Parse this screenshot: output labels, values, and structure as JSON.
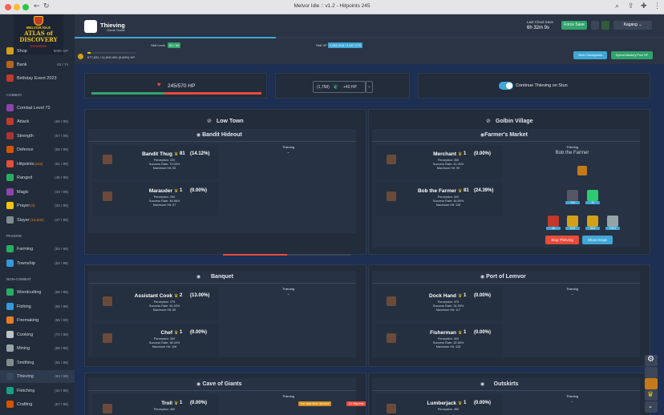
{
  "window": {
    "title": "Melvor Idle :: v1.2 - Hitpoints 245"
  },
  "logo": {
    "top": "MELVOR IDLE",
    "main": "ATLAS of DISCOVERY",
    "sub": "EXPANSION"
  },
  "sidebar": {
    "shop": {
      "label": "Shop",
      "badge": "500K GP"
    },
    "bank": {
      "label": "Bank",
      "count": "63 / 74"
    },
    "event": {
      "label": "Birthday Event 2023"
    },
    "combat_header": "COMBAT",
    "combat_level": "Combat Level 72",
    "combat": [
      {
        "label": "Attack",
        "count": "(65 / 99)",
        "sub": ""
      },
      {
        "label": "Strength",
        "count": "(57 / 99)",
        "sub": ""
      },
      {
        "label": "Defence",
        "count": "(55 / 99)",
        "sub": ""
      },
      {
        "label": "Hitpoints",
        "count": "(61 / 99)",
        "sub": "(245)"
      },
      {
        "label": "Ranged",
        "count": "(45 / 99)",
        "sub": ""
      },
      {
        "label": "Magic",
        "count": "(10 / 99)",
        "sub": ""
      },
      {
        "label": "Prayer",
        "count": "(20 / 99)",
        "sub": "(0)"
      },
      {
        "label": "Slayer",
        "count": "(47 / 99)",
        "sub": "(15,530)"
      }
    ],
    "passive_header": "PASSIVE",
    "passive": [
      {
        "label": "Farming",
        "count": "(62 / 99)"
      },
      {
        "label": "Township",
        "count": "(52 / 99)"
      }
    ],
    "noncombat_header": "NON-COMBAT",
    "noncombat": [
      {
        "label": "Woodcutting",
        "count": "(56 / 99)"
      },
      {
        "label": "Fishing",
        "count": "(68 / 99)"
      },
      {
        "label": "Firemaking",
        "count": "(56 / 99)"
      },
      {
        "label": "Cooking",
        "count": "(70 / 99)"
      },
      {
        "label": "Mining",
        "count": "(58 / 99)"
      },
      {
        "label": "Smithing",
        "count": "(56 / 99)"
      },
      {
        "label": "Thieving",
        "count": "(83 / 99)"
      },
      {
        "label": "Fletching",
        "count": "(34 / 99)"
      },
      {
        "label": "Crafting",
        "count": "(57 / 99)"
      }
    ]
  },
  "header": {
    "title": "Thieving",
    "subtitle": "Game Guide",
    "last_save_label": "Last Cloud Save",
    "last_save": "6h 32m 9s",
    "force_save": "Force Save",
    "user": "Kagang",
    "skill_level_label": "Skill Level",
    "skill_level": "83 / 99",
    "skill_xp_label": "Skill XP",
    "skill_xp": "2,651,918 / 2,827,075",
    "mastery_xp": "677,831 / 11,500,000 (5.89%) XP",
    "skill_progress": 0.9,
    "mastery_progress": 0.06,
    "view_checkpoints": "View Checkpoints",
    "spend_mastery": "Spend Mastery Pool XP"
  },
  "status": {
    "hp": "245/570 HP",
    "hp_fraction": 0.43,
    "food_qty": "(1,758)",
    "food_heal": "+40 HP",
    "toggle_label": "Continue Thieving on Stun"
  },
  "areas": [
    {
      "name": "Low Town",
      "cards": [
        {
          "title": "Bandit Hideout",
          "npcs": [
            {
              "name": "Bandit Thug",
              "mastery": "81",
              "pct": "(14.12%)",
              "stats": [
                "Perception: 220",
                "Success Rate: 70.00%",
                "Maximum Hit: 53"
              ]
            },
            {
              "name": "Marauder",
              "mastery": "1",
              "pct": "(0.00%)",
              "stats": [
                "Perception: 250",
                "Success Rate: 48.86%",
                "Maximum Hit: 67"
              ]
            }
          ],
          "thieving_label": "Thieving",
          "thieving_value": "-"
        }
      ]
    },
    {
      "name": "Golbin Village",
      "cards": [
        {
          "title": "Farmer's Market",
          "npcs": [
            {
              "name": "Merchant",
              "mastery": "1",
              "pct": "(0.00%)",
              "stats": [
                "Perception: 350",
                "Success Rate: 41.00%",
                "Maximum Hit: 99"
              ]
            },
            {
              "name": "Bob the Farmer",
              "mastery": "81",
              "pct": "(24.39%)",
              "stats": [
                "Perception: 420",
                "Success Rate: 46.80%",
                "Maximum Hit: 135"
              ]
            }
          ],
          "thieving_label": "Thieving",
          "thieving_value": "Bob the Farmer",
          "drops": [
            "144",
            "48",
            "38",
            "26.8",
            "26.8",
            "2,824"
          ],
          "stop": "Stop Thieving",
          "show_drops": "Show Drops"
        }
      ]
    }
  ],
  "cards2": [
    {
      "title": "Banquet",
      "npcs": [
        {
          "name": "Assistant Cook",
          "mastery": "2",
          "pct": "(13.00%)",
          "stats": [
            "Perception: 275",
            "Success Rate: 64.00%",
            "Maximum Hit: 85"
          ]
        },
        {
          "name": "Chef",
          "mastery": "1",
          "pct": "(0.00%)",
          "stats": [
            "Perception: 350",
            "Success Rate: 38.44%",
            "Maximum Hit: 106"
          ]
        }
      ],
      "thieving_label": "Thieving",
      "thieving_value": "-"
    },
    {
      "title": "Port of Lemvor",
      "npcs": [
        {
          "name": "Dock Hand",
          "mastery": "1",
          "pct": "(0.00%)",
          "stats": [
            "Perception: 375",
            "Success Rate: 34.53%",
            "Maximum Hit: 117"
          ]
        },
        {
          "name": "Fisherman",
          "mastery": "1",
          "pct": "(0.00%)",
          "stats": [
            "Perception: 400",
            "Success Rate: 32.80%",
            "Maximum Hit: 128"
          ]
        }
      ],
      "thieving_label": "Thieving",
      "thieving_value": "-"
    },
    {
      "title": "Cave of Giants",
      "npcs": [
        {
          "name": "Troll",
          "mastery": "1",
          "pct": "(0.00%)",
          "stats": [
            "Perception: 450"
          ]
        }
      ],
      "thieving_label": "Thieving",
      "thieving_value": ""
    },
    {
      "title": "Outskirts",
      "npcs": [
        {
          "name": "Lumberjack",
          "mastery": "1",
          "pct": "(0.00%)",
          "stats": [
            "Perception: 480"
          ]
        }
      ],
      "thieving_label": "Thieving",
      "thieving_value": "-"
    }
  ],
  "notifications": {
    "first": "You have been stunned",
    "second": "-31 Hitpoints"
  }
}
